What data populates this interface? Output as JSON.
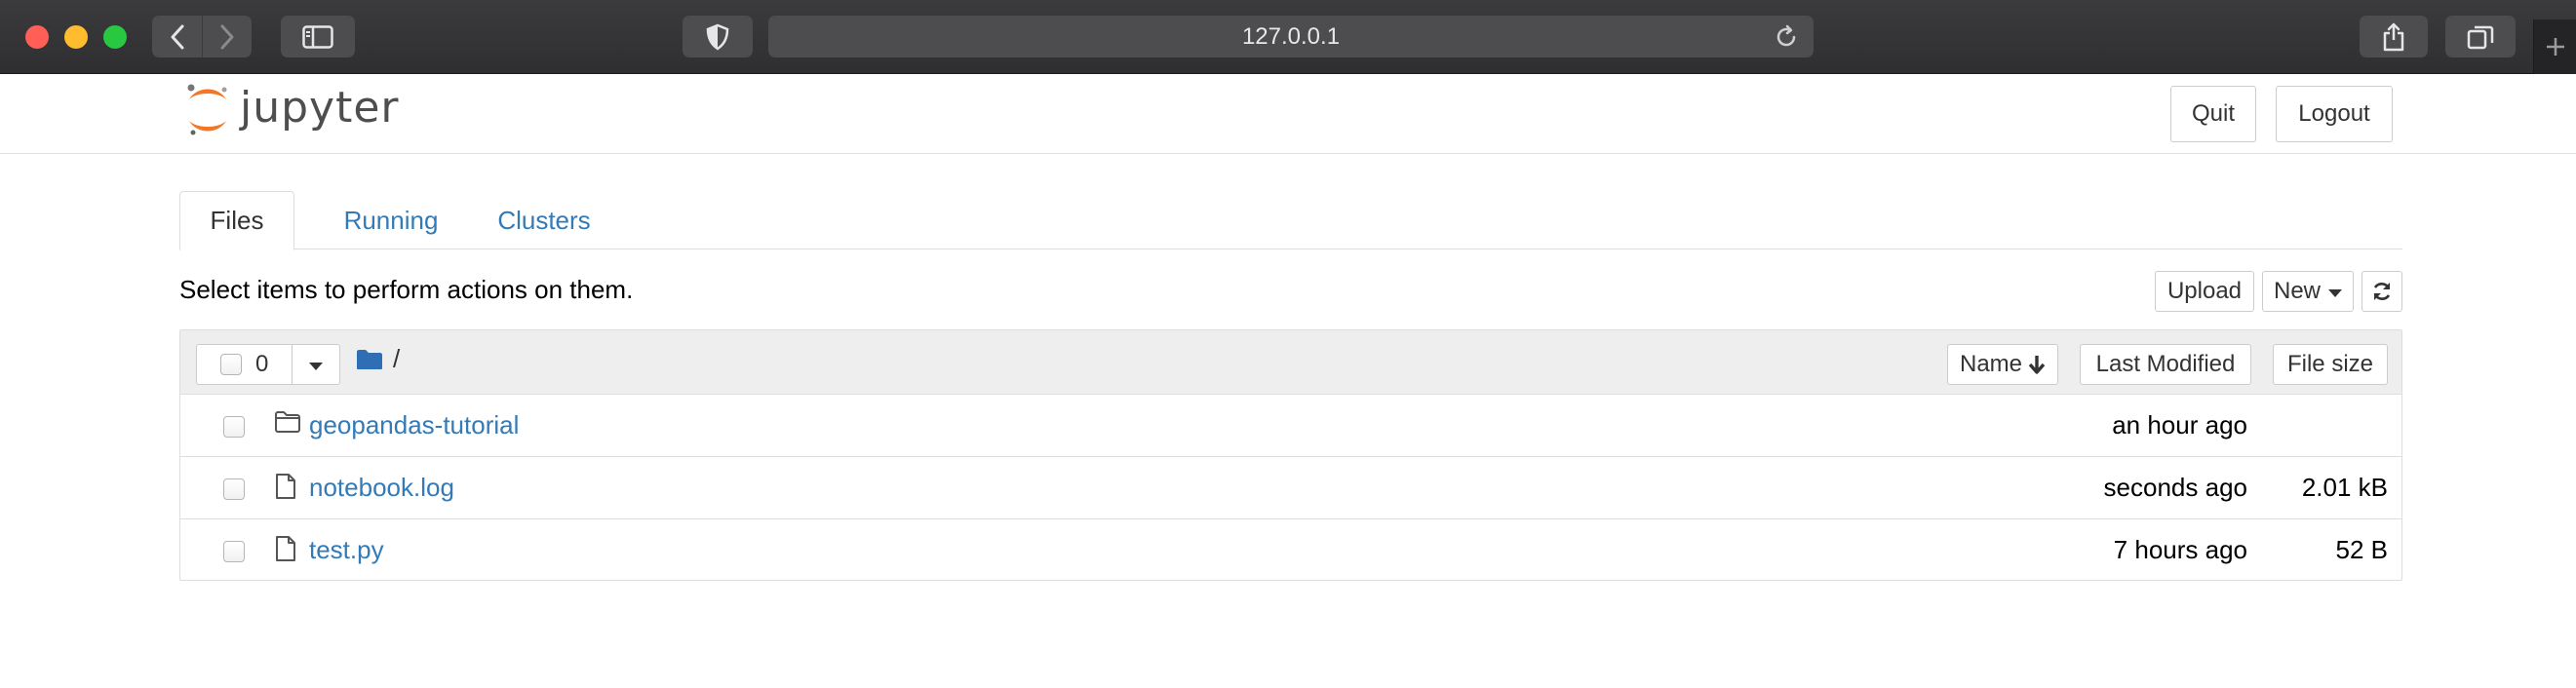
{
  "browser": {
    "url": "127.0.0.1",
    "buttons": {
      "back": "chevron-left-icon",
      "forward": "chevron-right-icon",
      "sidebar": "sidebar-icon",
      "privacy": "shield-icon",
      "reload": "reload-icon",
      "share": "share-icon",
      "tabs": "tabs-overview-icon",
      "new_tab": "plus-icon"
    }
  },
  "header": {
    "logo_text": "jupyter",
    "quit_label": "Quit",
    "logout_label": "Logout"
  },
  "tabs": [
    {
      "label": "Files",
      "active": true
    },
    {
      "label": "Running",
      "active": false
    },
    {
      "label": "Clusters",
      "active": false
    }
  ],
  "toolbar": {
    "message": "Select items to perform actions on them.",
    "upload_label": "Upload",
    "new_label": "New"
  },
  "list_header": {
    "selected_count": "0",
    "breadcrumb_path": "/",
    "sort_name_label": "Name",
    "sort_modified_label": "Last Modified",
    "sort_size_label": "File size"
  },
  "files": [
    {
      "name": "geopandas-tutorial",
      "type": "folder",
      "modified": "an hour ago",
      "size": ""
    },
    {
      "name": "notebook.log",
      "type": "file",
      "modified": "seconds ago",
      "size": "2.01 kB"
    },
    {
      "name": "test.py",
      "type": "file",
      "modified": "7 hours ago",
      "size": "52 B"
    }
  ],
  "colors": {
    "link": "#337ab7",
    "logo_orange": "#f37726",
    "folder_blue": "#2f6db5"
  }
}
